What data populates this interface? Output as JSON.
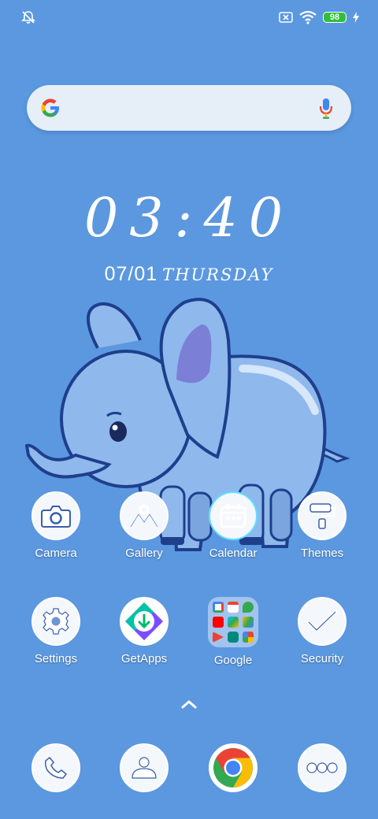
{
  "status_bar": {
    "battery_level": "98",
    "icons": [
      "notifications-off-icon",
      "no-sim-icon",
      "wifi-icon",
      "battery-icon",
      "charging-bolt-icon"
    ]
  },
  "search": {
    "logo": "google-logo",
    "mic": "microphone-icon"
  },
  "clock": {
    "time": "03:40",
    "date": "07/01",
    "weekday": "THURSDAY"
  },
  "apps_row1": [
    {
      "label": "Camera",
      "icon": "camera-icon"
    },
    {
      "label": "Gallery",
      "icon": "gallery-icon"
    },
    {
      "label": "Calendar",
      "icon": "calendar-icon"
    },
    {
      "label": "Themes",
      "icon": "paint-roller-icon"
    }
  ],
  "apps_row2": [
    {
      "label": "Settings",
      "icon": "gear-icon"
    },
    {
      "label": "GetApps",
      "icon": "getapps-icon"
    },
    {
      "label": "Google",
      "icon": "google-folder-icon"
    },
    {
      "label": "Security",
      "icon": "security-check-icon"
    }
  ],
  "dock": [
    {
      "icon": "phone-icon"
    },
    {
      "icon": "messages-icon"
    },
    {
      "icon": "chrome-icon"
    },
    {
      "icon": "more-apps-icon"
    }
  ],
  "colors": {
    "wallpaper": "#5b98e0",
    "battery": "#2fbf3a",
    "elephant": "#8fb8ec",
    "outline": "#1e3f8c"
  }
}
